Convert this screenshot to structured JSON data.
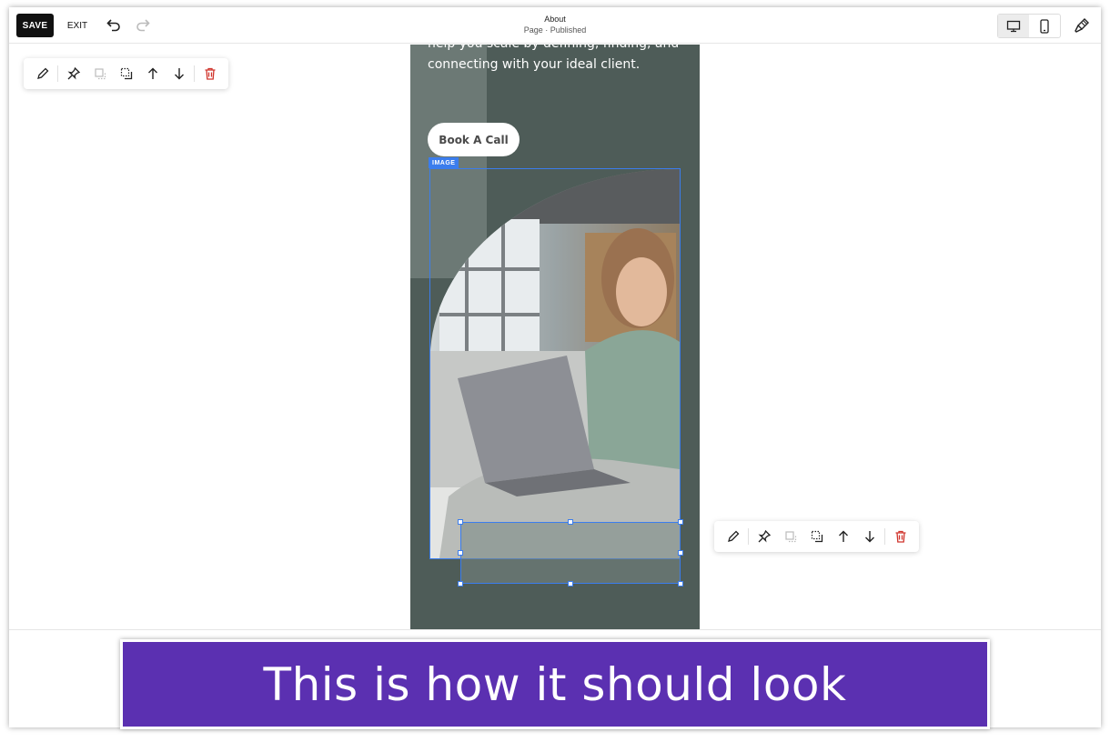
{
  "toolbar": {
    "save_label": "SAVE",
    "exit_label": "EXIT",
    "page_title": "About",
    "page_status": "Page · Published",
    "icons": [
      "undo-icon",
      "redo-icon",
      "desktop-icon",
      "mobile-icon",
      "paintbrush-icon"
    ]
  },
  "hero": {
    "line1": "help you scale by defining, finding, and",
    "line2": "connecting with your ideal client.",
    "button_label": "Book A Call"
  },
  "image_block": {
    "label": "IMAGE"
  },
  "block_toolbar": {
    "icons": [
      "pencil-icon",
      "pin-icon",
      "arrange-icon",
      "duplicate-icon",
      "arrow-up-icon",
      "arrow-down-icon",
      "trash-icon"
    ]
  },
  "banner": {
    "text": "This is how it should look"
  },
  "colors": {
    "accent_blue": "#3b7ded",
    "section_bg": "#4e5c58",
    "banner_bg": "#5b30b1",
    "delete_red": "#d0342c"
  }
}
